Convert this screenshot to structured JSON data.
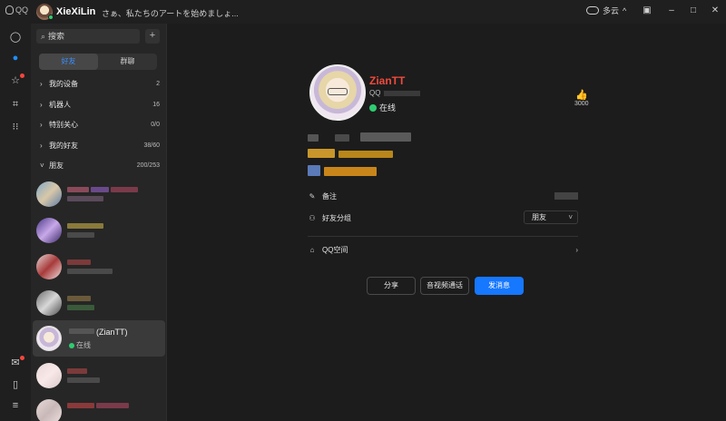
{
  "app": {
    "logo": "QQ"
  },
  "titlebar": {
    "username": "XieXiLin",
    "signature": "さぁ、私たちのアートを始めましょ...",
    "weather": "多云",
    "weather_icon": "cloud-icon"
  },
  "rail": {
    "icons": [
      "chat-icon",
      "contacts-icon",
      "space-icon",
      "games-icon",
      "apps-icon",
      "mail-icon",
      "phone-icon",
      "menu-icon"
    ],
    "active": "contacts-icon"
  },
  "contacts": {
    "search_placeholder": "搜索",
    "add_label": "+",
    "tabs": [
      {
        "label": "好友",
        "active": true
      },
      {
        "label": "群聊",
        "active": false
      }
    ],
    "groups": [
      {
        "name": "我的设备",
        "count": "2",
        "expanded": false
      },
      {
        "name": "机器人",
        "count": "16",
        "expanded": false
      },
      {
        "name": "特别关心",
        "count": "0/0",
        "expanded": false
      },
      {
        "name": "我的好友",
        "count": "38/60",
        "expanded": false
      },
      {
        "name": "朋友",
        "count": "200/253",
        "expanded": true
      }
    ],
    "selected_friend": {
      "name": "(ZianTT)",
      "status": "在线"
    }
  },
  "profile": {
    "name": "ZianTT",
    "qq_label": "QQ",
    "status": "在线",
    "likes": "3000",
    "remark_label": "备注",
    "group_label": "好友分组",
    "group_value": "朋友",
    "qzone_label": "QQ空间",
    "buttons": {
      "share": "分享",
      "call": "音视频通话",
      "message": "发消息"
    }
  },
  "colors": {
    "accent": "#1677ff",
    "name_red": "#f04a3c",
    "online": "#2ecc71",
    "notify": "#f5463d"
  }
}
